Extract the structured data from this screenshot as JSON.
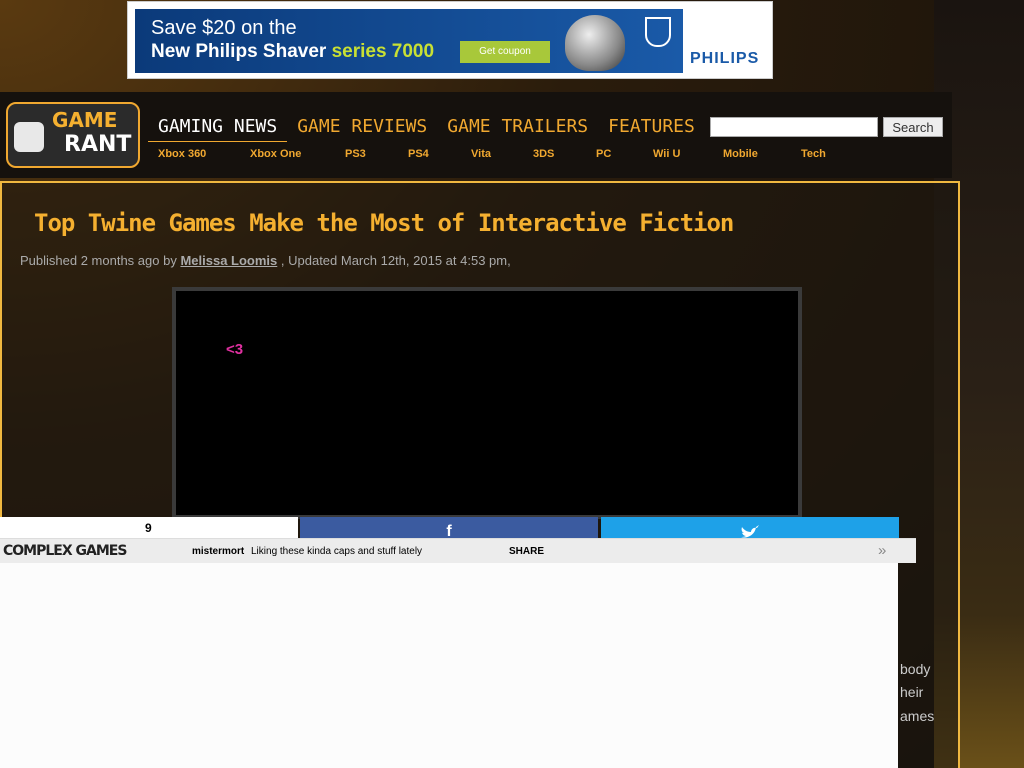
{
  "ad": {
    "line1": "Save $20 on the",
    "line2_prefix": "New Philips Shaver ",
    "line2_highlight": "series 7000",
    "coupon_label": "Get coupon",
    "brand": "PHILIPS"
  },
  "header": {
    "logo_line1": "GAME",
    "logo_line2": "RANT",
    "nav": [
      {
        "label": "GAMING NEWS",
        "active": true
      },
      {
        "label": "GAME REVIEWS"
      },
      {
        "label": "GAME TRAILERS"
      },
      {
        "label": "FEATURES"
      }
    ],
    "subnav": [
      "Xbox 360",
      "Xbox One",
      "PS3",
      "PS4",
      "Vita",
      "3DS",
      "PC",
      "Wii U",
      "Mobile",
      "Tech"
    ],
    "search_value": "",
    "search_button": "Search"
  },
  "article": {
    "title": "Top Twine Games Make the Most of Interactive Fiction",
    "byline_prefix": "Published 2 months ago by",
    "author": "Melissa Loomis",
    "byline_suffix": ", Updated March 12th, 2015 at 4:53 pm,",
    "video_text": "<3",
    "body_fragments": [
      "body",
      "heir",
      "ames"
    ]
  },
  "share": {
    "count": "9",
    "facebook_icon": "f",
    "twitter_icon": "twitter-bird"
  },
  "complex_bar": {
    "logo": "COMPLEX GAMES",
    "user": "mistermort",
    "message": "Liking these kinda caps and stuff lately",
    "share_label": "SHARE",
    "next_glyph": "»"
  }
}
